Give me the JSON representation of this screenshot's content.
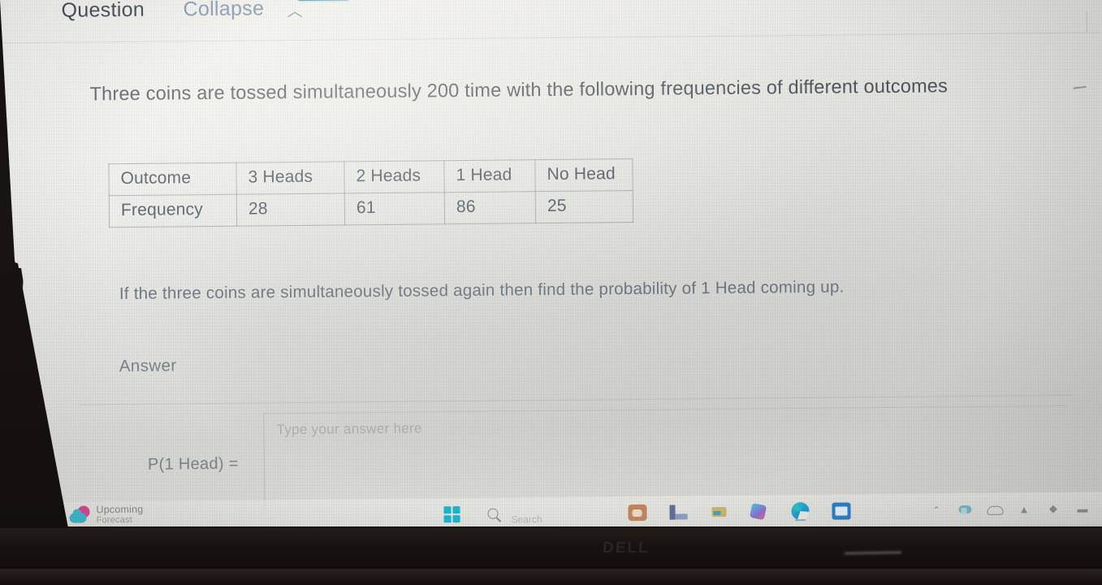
{
  "toolbar": {
    "question_label": "Question",
    "collapse_label": "Collapse",
    "collapse_caret": "︿"
  },
  "question": {
    "intro": "Three coins are tossed simultaneously 200 time with the following frequencies of different outcomes",
    "follow_up": "If the three coins are simultaneously tossed again then find the probability of 1 Head coming up."
  },
  "table": {
    "row_headers": [
      "Outcome",
      "Frequency"
    ],
    "outcomes": [
      "3 Heads",
      "2 Heads",
      "1 Head",
      "No Head"
    ],
    "frequencies": [
      "28",
      "61",
      "86",
      "25"
    ],
    "cells": {
      "r0c0": "Outcome",
      "r0c1": "3 Heads",
      "r0c2": "2 Heads",
      "r0c3": "1 Head",
      "r0c4": "No Head",
      "r1c0": "Frequency",
      "r1c1": "28",
      "r1c2": "61",
      "r1c3": "86",
      "r1c4": "25"
    }
  },
  "answer": {
    "label": "Answer",
    "placeholder": "Type your answer here",
    "expression": "P(1 Head) ="
  },
  "taskbar": {
    "weather_title": "Upcoming",
    "weather_sub": "Forecast",
    "search_placeholder": "Search",
    "icons": [
      "start-icon",
      "search-icon",
      "photos-icon",
      "file-explorer-icon",
      "teams-icon",
      "store-icon",
      "edge-icon",
      "mail-icon"
    ],
    "tray_icons": [
      "chevron-up-icon",
      "onedrive-icon",
      "cloud-icon",
      "network-icon",
      "volume-icon",
      "battery-icon"
    ],
    "tray_chevron": "⌃",
    "tray_network": "▲",
    "tray_volume": "◆",
    "tray_battery": "▬"
  },
  "device": {
    "brand": "DELL"
  },
  "colors": {
    "accent_teal": "#1ab6cd",
    "text_primary": "#41484f",
    "text_secondary": "#6d7680",
    "screen_bg": "#e9e9e4",
    "bezel": "#16120f"
  }
}
